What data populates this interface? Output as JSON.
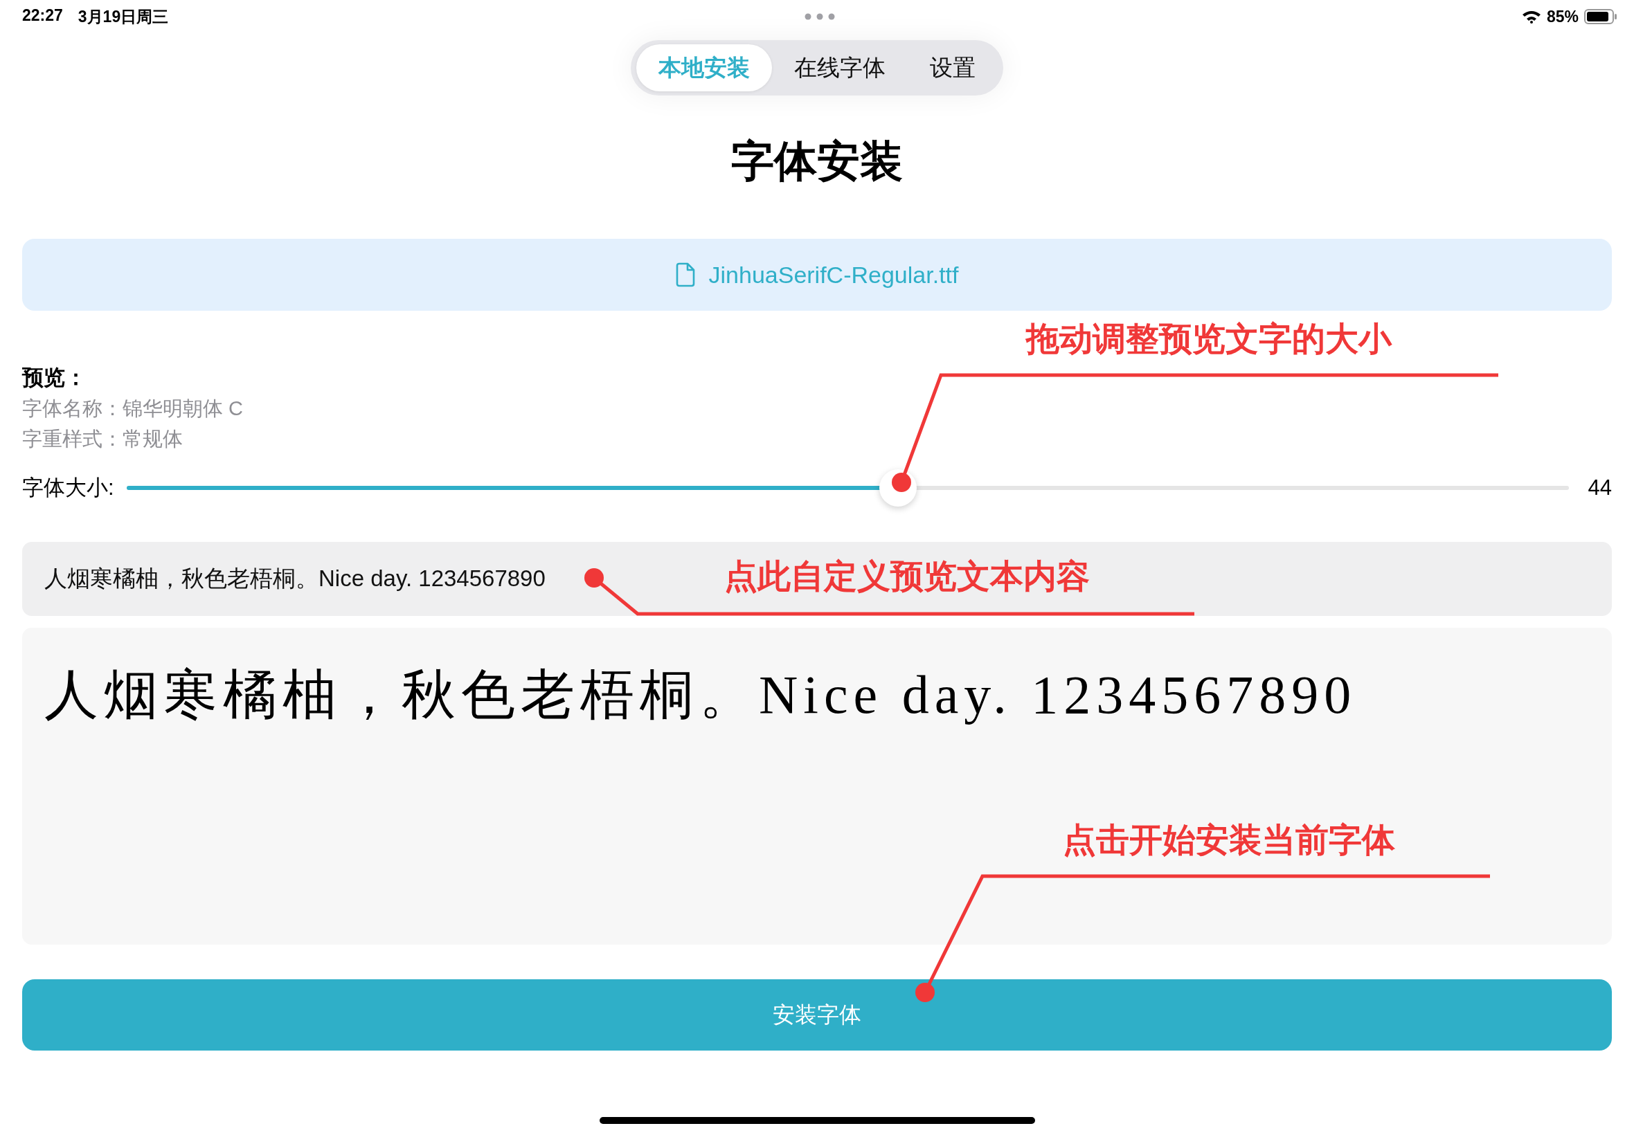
{
  "status_bar": {
    "time": "22:27",
    "date": "3月19日周三",
    "battery": "85%"
  },
  "tabs": [
    {
      "label": "本地安装",
      "selected": true
    },
    {
      "label": "在线字体",
      "selected": false
    },
    {
      "label": "设置",
      "selected": false
    }
  ],
  "title": "字体安装",
  "file": {
    "name": "JinhuaSerifC-Regular.ttf"
  },
  "preview": {
    "heading": "预览：",
    "font_name": "字体名称：锦华明朝体 C",
    "font_weight": "字重样式：常规体"
  },
  "font_size": {
    "label": "字体大小:",
    "level": 0.535,
    "reading": "44"
  },
  "sample_input": {
    "value": "人烟寒橘柚，秋色老梧桐。Nice day. 1234567890"
  },
  "sample_preview": "人烟寒橘柚，秋色老梧桐。Nice day. 1234567890",
  "install_button": "安装字体",
  "annotations": [
    {
      "text": "拖动调整预览文字的大小"
    },
    {
      "text": "点此自定义预览文本内容"
    },
    {
      "text": "点击开始安装当前字体"
    }
  ]
}
